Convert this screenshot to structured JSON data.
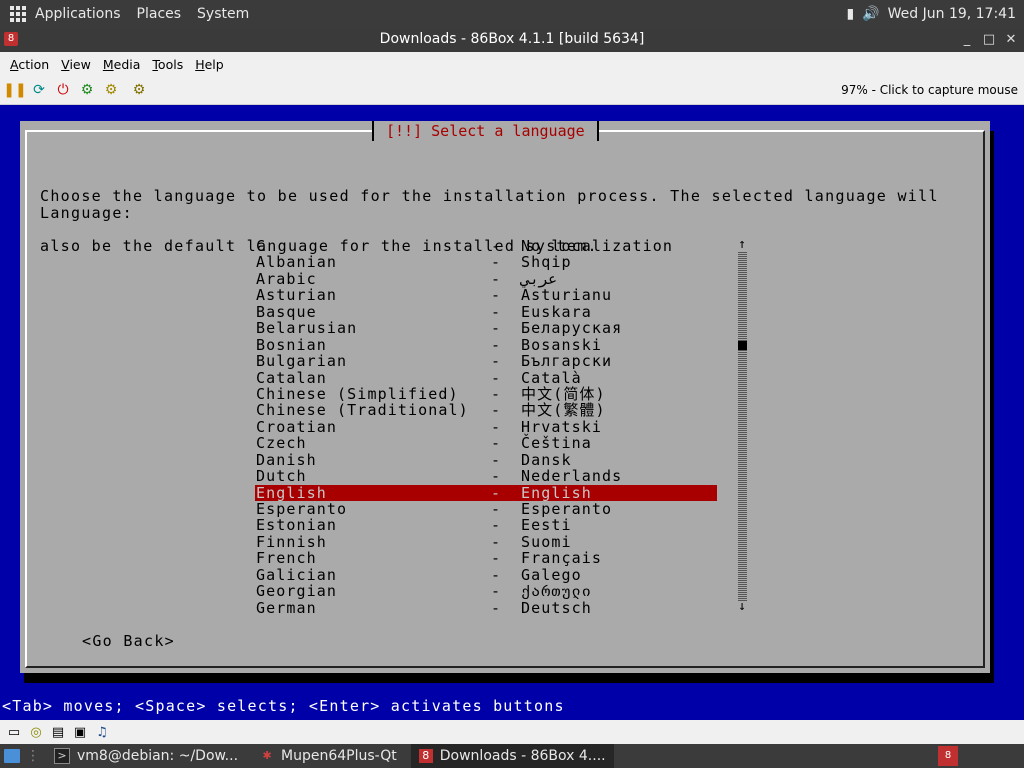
{
  "top_panel": {
    "menus": [
      "Applications",
      "Places",
      "System"
    ],
    "datetime": "Wed Jun 19, 17:41"
  },
  "window": {
    "title": "Downloads - 86Box 4.1.1 [build 5634]",
    "menubar": [
      "Action",
      "View",
      "Media",
      "Tools",
      "Help"
    ],
    "toolbar_status": "97% - Click to capture mouse"
  },
  "installer": {
    "dialog_title": "[!!] Select a language",
    "intro_line1": "Choose the language to be used for the installation process. The selected language will",
    "intro_line2": "also be the default language for the installed system.",
    "language_label": "Language:",
    "separator": "-",
    "selected_index": 15,
    "languages": [
      {
        "name": "C",
        "native": "No localization"
      },
      {
        "name": "Albanian",
        "native": "Shqip"
      },
      {
        "name": "Arabic",
        "native": "عربي"
      },
      {
        "name": "Asturian",
        "native": "Asturianu"
      },
      {
        "name": "Basque",
        "native": "Euskara"
      },
      {
        "name": "Belarusian",
        "native": "Беларуская"
      },
      {
        "name": "Bosnian",
        "native": "Bosanski"
      },
      {
        "name": "Bulgarian",
        "native": "Български"
      },
      {
        "name": "Catalan",
        "native": "Català"
      },
      {
        "name": "Chinese (Simplified)",
        "native": "中文(简体)"
      },
      {
        "name": "Chinese (Traditional)",
        "native": "中文(繁體)"
      },
      {
        "name": "Croatian",
        "native": "Hrvatski"
      },
      {
        "name": "Czech",
        "native": "Čeština"
      },
      {
        "name": "Danish",
        "native": "Dansk"
      },
      {
        "name": "Dutch",
        "native": "Nederlands"
      },
      {
        "name": "English",
        "native": "English"
      },
      {
        "name": "Esperanto",
        "native": "Esperanto"
      },
      {
        "name": "Estonian",
        "native": "Eesti"
      },
      {
        "name": "Finnish",
        "native": "Suomi"
      },
      {
        "name": "French",
        "native": "Français"
      },
      {
        "name": "Galician",
        "native": "Galego"
      },
      {
        "name": "Georgian",
        "native": "ქართული"
      },
      {
        "name": "German",
        "native": "Deutsch"
      }
    ],
    "go_back_label": "<Go Back>",
    "help_line": "<Tab> moves; <Space> selects; <Enter> activates buttons"
  },
  "taskbar": {
    "tasks": [
      {
        "label": "vm8@debian: ~/Dow...",
        "icon": "terminal-icon"
      },
      {
        "label": "Mupen64Plus-Qt",
        "icon": "mupen-icon"
      },
      {
        "label": "Downloads - 86Box 4....",
        "icon": "86box-icon"
      }
    ]
  },
  "colors": {
    "screen_blue": "#0000a8",
    "dialog_gray": "#aaaaaa",
    "selection_red": "#a80000"
  }
}
